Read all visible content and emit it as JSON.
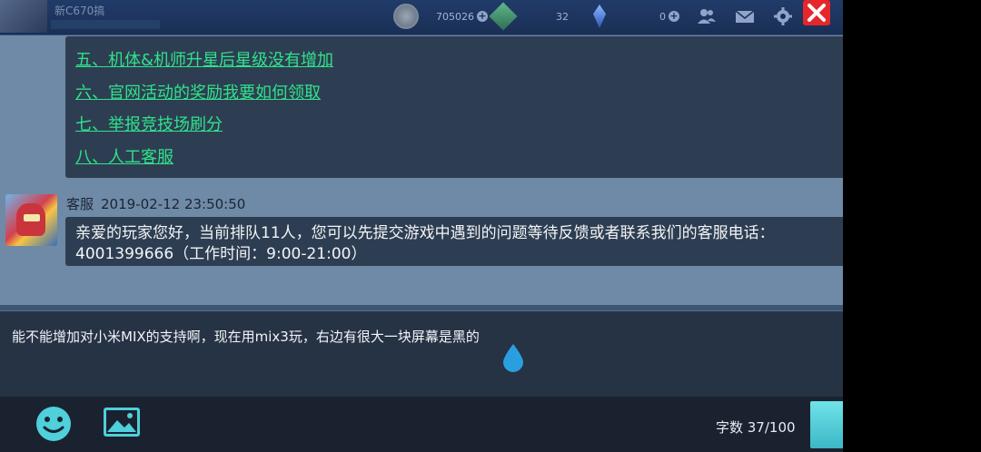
{
  "topbar": {
    "player_name": "新C670搞",
    "coins": "705026",
    "gems": "32",
    "crystals": "0"
  },
  "faq_links": [
    "五、机体&机师升星后星级没有增加",
    "六、官网活动的奖励我要如何领取",
    "七、举报竞技场刷分",
    "八、人工客服"
  ],
  "message": {
    "sender": "客服",
    "timestamp": "2019-02-12 23:50:50",
    "line1": "亲爱的玩家您好，当前排队11人，您可以先提交游戏中遇到的问题等待反馈或者联系我们的客服电话：",
    "line2": "4001399666（工作时间：9:00-21:00）"
  },
  "input": {
    "value": "能不能增加对小米MIX的支持啊，现在用mix3玩，右边有很大一块屏幕是黑的"
  },
  "counter": {
    "label": "字数 37/100"
  },
  "icons": {
    "emoji": "emoji-icon",
    "image": "image-icon",
    "friends": "friends-icon",
    "mail": "mail-icon",
    "settings": "gear-icon",
    "close": "close-icon"
  },
  "colors": {
    "link": "#2fe28b",
    "close": "#e5262a",
    "send": "#4fcbd6"
  }
}
